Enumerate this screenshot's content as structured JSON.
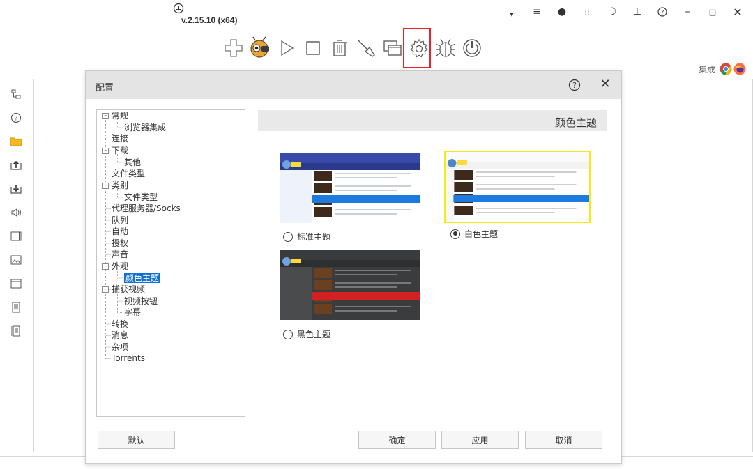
{
  "app": {
    "version": "v.2.15.10 (x64)"
  },
  "window_controls": [
    {
      "name": "dropdown-icon",
      "glyph": "▾"
    },
    {
      "name": "menu-icon",
      "glyph": "≡"
    },
    {
      "name": "record-icon",
      "glyph": "●"
    },
    {
      "name": "stats-icon",
      "glyph": "⁝"
    },
    {
      "name": "moon-icon",
      "glyph": "☽"
    },
    {
      "name": "pin-icon",
      "glyph": "⊥"
    },
    {
      "name": "help-icon",
      "glyph": "?"
    },
    {
      "name": "minimize-icon",
      "glyph": "–"
    },
    {
      "name": "maximize-icon",
      "glyph": "▫"
    },
    {
      "name": "close-icon",
      "glyph": "✕"
    }
  ],
  "toolbar": {
    "items": [
      "add-icon",
      "grabber-icon",
      "start-icon",
      "stop-icon",
      "delete-icon",
      "clean-icon",
      "windows-icon",
      "settings-icon",
      "bug-icon",
      "power-icon"
    ]
  },
  "integration": {
    "label": "集成",
    "browsers": [
      "chrome-icon",
      "firefox-icon"
    ]
  },
  "sidebar": {
    "items": [
      "tree-icon",
      "help-circle-icon",
      "folder-icon",
      "upload-icon",
      "download-icon",
      "audio-icon",
      "video-icon",
      "image-icon",
      "window-icon",
      "document-icon",
      "archive-icon"
    ]
  },
  "dialog": {
    "title": "配置",
    "tree": [
      {
        "label": "常规",
        "level": 0,
        "expander": "-"
      },
      {
        "label": "浏览器集成",
        "level": 1
      },
      {
        "label": "连接",
        "level": 0
      },
      {
        "label": "下载",
        "level": 0,
        "expander": "-"
      },
      {
        "label": "其他",
        "level": 1
      },
      {
        "label": "文件类型",
        "level": 0
      },
      {
        "label": "类别",
        "level": 0,
        "expander": "-"
      },
      {
        "label": "文件类型",
        "level": 1
      },
      {
        "label": "代理服务器/Socks",
        "level": 0
      },
      {
        "label": "队列",
        "level": 0
      },
      {
        "label": "自动",
        "level": 0
      },
      {
        "label": "授权",
        "level": 0
      },
      {
        "label": "声音",
        "level": 0
      },
      {
        "label": "外观",
        "level": 0,
        "expander": "-"
      },
      {
        "label": "颜色主题",
        "level": 1,
        "selected": true
      },
      {
        "label": "捕获视频",
        "level": 0,
        "expander": "-"
      },
      {
        "label": "视频按钮",
        "level": 1
      },
      {
        "label": "字幕",
        "level": 1
      },
      {
        "label": "转换",
        "level": 0
      },
      {
        "label": "消息",
        "level": 0
      },
      {
        "label": "杂项",
        "level": 0
      },
      {
        "label": "Torrents",
        "level": 0
      }
    ],
    "section_title": "颜色主题",
    "themes": [
      {
        "label": "标准主题",
        "selected": false
      },
      {
        "label": "白色主题",
        "selected": true
      },
      {
        "label": "黑色主题",
        "selected": false
      }
    ],
    "buttons": {
      "default": "默认",
      "ok": "确定",
      "apply": "应用",
      "cancel": "取消"
    }
  },
  "colors": {
    "accent_red": "#e8212a",
    "selection_blue": "#1070d8",
    "theme_highlight": "#f5ea16"
  }
}
